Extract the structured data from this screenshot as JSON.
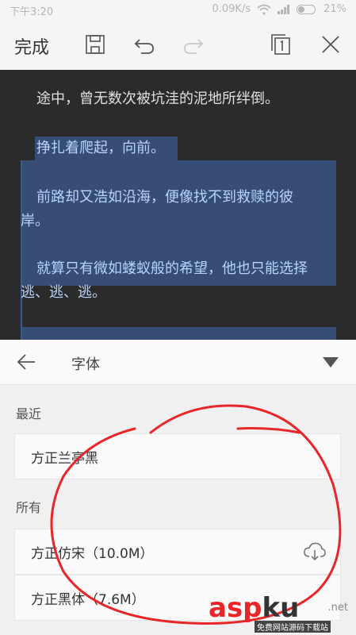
{
  "status_bar": {
    "time": "下午3:20",
    "speed": "0.09K/s",
    "battery": "21%"
  },
  "toolbar": {
    "done_label": "完成"
  },
  "document": {
    "paragraphs": [
      {
        "text": "途中，曾无数次被坑洼的泥地所绊倒。",
        "selected": false
      },
      {
        "text": "挣扎着爬起，向前。",
        "selected": true
      },
      {
        "text": "前路却又浩如沿海，便像找不到救赎的彼",
        "selected": true
      },
      {
        "text": "岸。",
        "selected": true
      },
      {
        "text": "就算只有微如蝼蚁般的希望，他也只能选择",
        "selected": true
      },
      {
        "text": "逃、逃、逃。",
        "selected": true
      }
    ]
  },
  "panel": {
    "title": "字体",
    "recent_label": "最近",
    "all_label": "所有",
    "recent_fonts": [
      {
        "label": "方正兰亭黑"
      }
    ],
    "all_fonts": [
      {
        "label": "方正仿宋（10.0M）",
        "downloadable": true
      },
      {
        "label": "方正黑体（7.6M）",
        "downloadable": false
      }
    ]
  },
  "watermark": {
    "brand_prefix": "asp",
    "brand_ku": "ku",
    "brand_net": ".net",
    "tagline": "免费网站源码下载站"
  },
  "colors": {
    "selection": "#3b5a8f",
    "annotation": "#e8262a",
    "document_bg": "#2b2b2b"
  }
}
